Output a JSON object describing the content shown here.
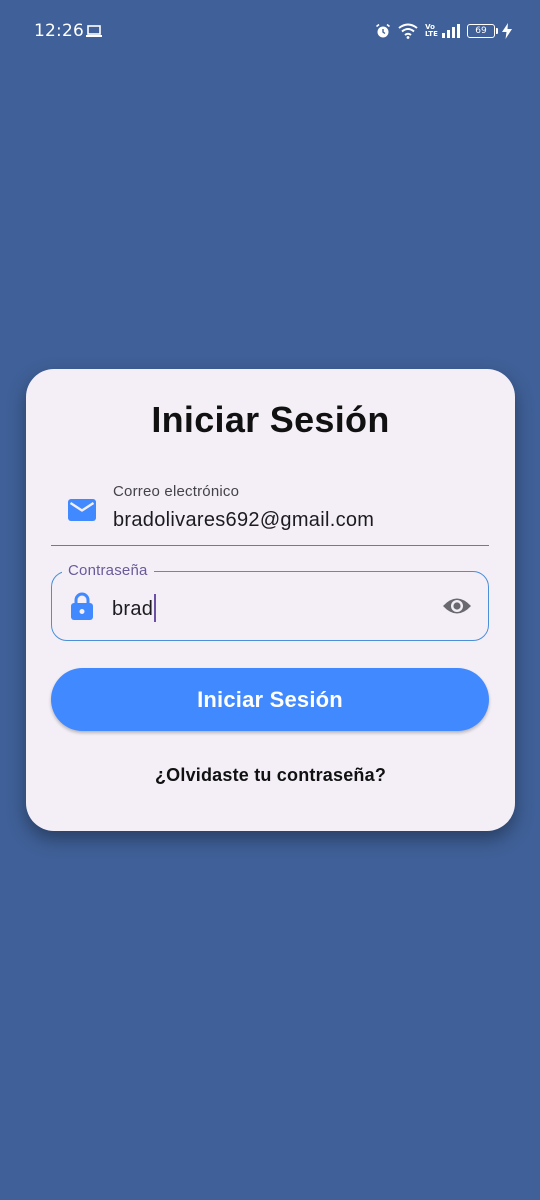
{
  "status_bar": {
    "time": "12:26",
    "battery_level": "69",
    "network_label": "Vo LTE",
    "icons": [
      "laptop-icon",
      "alarm-icon",
      "wifi-icon",
      "signal-icon",
      "battery-icon",
      "charging-icon"
    ]
  },
  "login": {
    "title": "Iniciar Sesión",
    "email": {
      "label": "Correo electrónico",
      "value": "bradolivares692@gmail.com",
      "icon": "mail-icon"
    },
    "password": {
      "label": "Contraseña",
      "value": "brad",
      "icon": "lock-icon",
      "toggle_icon": "eye-icon"
    },
    "submit_label": "Iniciar Sesión",
    "forgot_label": "¿Olvidaste tu contraseña?"
  },
  "colors": {
    "background": "#3f6098",
    "card": "#f4eff7",
    "primary_button": "#4189ff",
    "focus_border": "#4a8fd8",
    "label_accent": "#6a5a9a"
  }
}
